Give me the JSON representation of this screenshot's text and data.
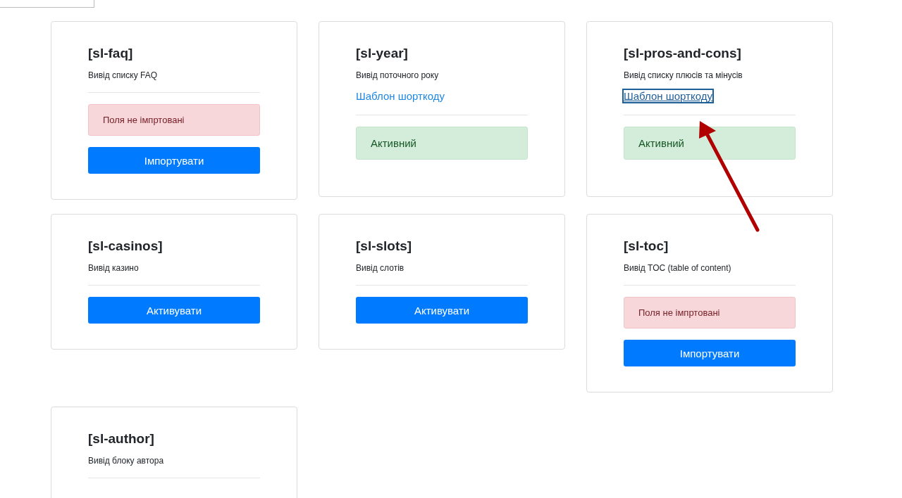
{
  "cards": [
    {
      "title": "[sl-faq]",
      "description": "Вивід списку FAQ",
      "items": [
        {
          "kind": "alert-danger",
          "text": "Поля не імпртовані"
        },
        {
          "kind": "button",
          "text": "Імпортувати"
        }
      ]
    },
    {
      "title": "[sl-year]",
      "description": "Вивід поточного року",
      "link": {
        "label": "Шаблон шорткоду",
        "focused": false
      },
      "items": [
        {
          "kind": "alert-success",
          "text": "Активний"
        }
      ]
    },
    {
      "title": "[sl-pros-and-cons]",
      "description": "Вивід списку плюсів та мінусів",
      "link": {
        "label": "Шаблон шорткоду",
        "focused": true
      },
      "items": [
        {
          "kind": "alert-success",
          "text": "Активний"
        }
      ]
    },
    {
      "title": "[sl-casinos]",
      "description": "Вивід казино",
      "items": [
        {
          "kind": "button",
          "text": "Активувати"
        }
      ]
    },
    {
      "title": "[sl-slots]",
      "description": "Вивід слотів",
      "items": [
        {
          "kind": "button",
          "text": "Активувати"
        }
      ]
    },
    {
      "title": "[sl-toc]",
      "description": "Вивід TOC (table of content)",
      "items": [
        {
          "kind": "alert-danger",
          "text": "Поля не імпртовані"
        },
        {
          "kind": "button",
          "text": "Імпортувати"
        }
      ]
    },
    {
      "title": "[sl-author]",
      "description": "Вивід блоку автора"
    }
  ]
}
